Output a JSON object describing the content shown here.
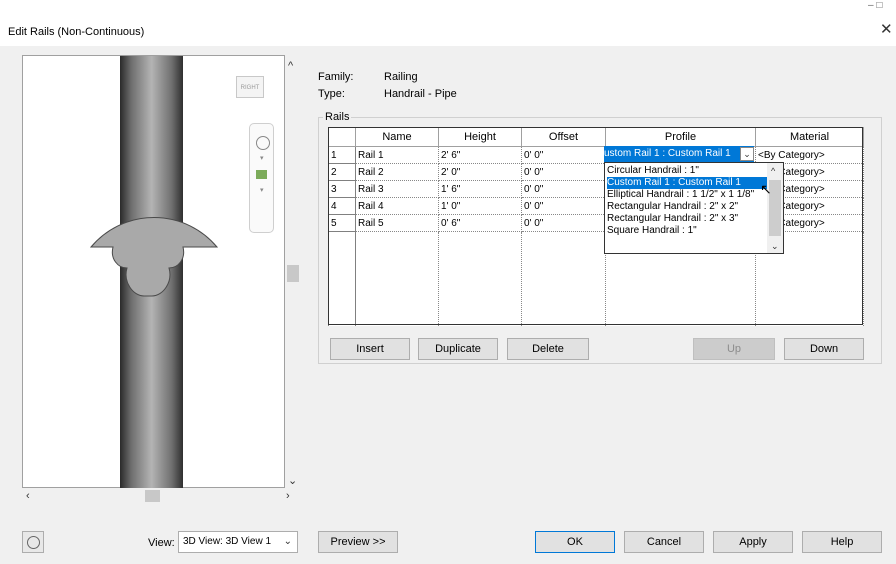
{
  "window": {
    "title": "Edit Rails (Non-Continuous)"
  },
  "preview": {
    "viewcube_label": "RIGHT",
    "view_label": "View:",
    "view_value": "3D View: 3D View 1",
    "preview_button": "Preview >>"
  },
  "info": {
    "family_label": "Family:",
    "family_value": "Railing",
    "type_label": "Type:",
    "type_value": "Handrail - Pipe"
  },
  "rails": {
    "group_label": "Rails",
    "columns": [
      "Name",
      "Height",
      "Offset",
      "Profile",
      "Material"
    ],
    "rows": [
      {
        "num": "1",
        "name": "Rail 1",
        "height": "2'  6\"",
        "offset": "0'  0\"",
        "profile": "Custom Rail 1 : Custom Rail 1",
        "material": "<By Category>"
      },
      {
        "num": "2",
        "name": "Rail 2",
        "height": "2'  0\"",
        "offset": "0'  0\"",
        "profile": "",
        "material": "<By Category>"
      },
      {
        "num": "3",
        "name": "Rail 3",
        "height": "1'  6\"",
        "offset": "0'  0\"",
        "profile": "",
        "material": "<By Category>"
      },
      {
        "num": "4",
        "name": "Rail 4",
        "height": "1'  0\"",
        "offset": "0'  0\"",
        "profile": "",
        "material": "<By Category>"
      },
      {
        "num": "5",
        "name": "Rail 5",
        "height": "0'  6\"",
        "offset": "0'  0\"",
        "profile": "",
        "material": "<By Category>"
      }
    ],
    "dropdown": {
      "selected_display": "ustom Rail 1 : Custom Rail 1",
      "options": [
        "Circular Handrail : 1\"",
        "Custom Rail 1 : Custom Rail 1",
        "Elliptical Handrail : 1 1/2\" x 1 1/8\"",
        "Rectangular Handrail : 2\" x 2\"",
        "Rectangular Handrail : 2\" x 3\"",
        "Square Handrail : 1\""
      ],
      "highlighted_index": 1
    },
    "buttons": {
      "insert": "Insert",
      "duplicate": "Duplicate",
      "delete": "Delete",
      "up": "Up",
      "down": "Down"
    }
  },
  "footer": {
    "ok": "OK",
    "cancel": "Cancel",
    "apply": "Apply",
    "help": "Help"
  },
  "colors": {
    "selection": "#0078d7",
    "profile_fill": "#a9a9a9"
  }
}
